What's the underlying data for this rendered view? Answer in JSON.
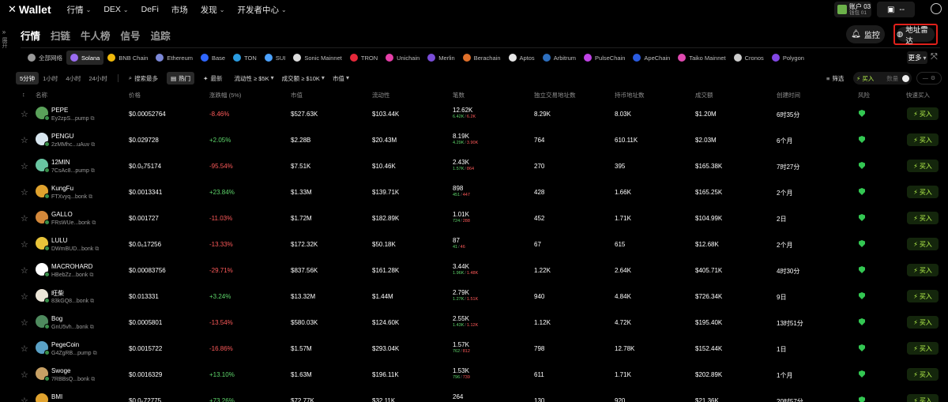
{
  "nav": {
    "logo_text": "Wallet",
    "items": [
      "行情",
      "DEX",
      "DeFi",
      "市场",
      "发现",
      "开发者中心"
    ],
    "account_name": "账户 03",
    "account_sub": "钱包 01",
    "account2_text": "--"
  },
  "sidebar": {
    "label": "展开"
  },
  "page_tabs": [
    "行情",
    "扫链",
    "牛人榜",
    "信号",
    "追踪"
  ],
  "actions": {
    "monitor": "监控",
    "address_radar": "地址雷达"
  },
  "chains": [
    {
      "name": "全部网络",
      "color": "#999999"
    },
    {
      "name": "Solana",
      "color": "#9a6cf0"
    },
    {
      "name": "BNB Chain",
      "color": "#f0b90b"
    },
    {
      "name": "Ethereum",
      "color": "#7c88d8"
    },
    {
      "name": "Base",
      "color": "#2f66ff"
    },
    {
      "name": "TON",
      "color": "#2a9be0"
    },
    {
      "name": "SUI",
      "color": "#4ca2ff"
    },
    {
      "name": "Sonic Mainnet",
      "color": "#dddddd"
    },
    {
      "name": "TRON",
      "color": "#e6283a"
    },
    {
      "name": "Unichain",
      "color": "#e63fa8"
    },
    {
      "name": "Merlin",
      "color": "#7a4dd8"
    },
    {
      "name": "Berachain",
      "color": "#e0702a"
    },
    {
      "name": "Aptos",
      "color": "#e6e6e6"
    },
    {
      "name": "Arbitrum",
      "color": "#2d6fbf"
    },
    {
      "name": "PulseChain",
      "color": "#c043e6"
    },
    {
      "name": "ApeChain",
      "color": "#2a5be0"
    },
    {
      "name": "Taiko Mainnet",
      "color": "#e04ab0"
    },
    {
      "name": "Cronos",
      "color": "#cccccc"
    },
    {
      "name": "Polygon",
      "color": "#8247e5"
    }
  ],
  "more_label": "更多",
  "filters": {
    "timeframes": [
      "5分钟",
      "1小时",
      "4小时",
      "24小时"
    ],
    "sorts": [
      "搜索最多",
      "热门",
      "最新"
    ],
    "dropdowns": [
      "流动性 ≥ $5K",
      "成交额 ≥ $10K",
      "市值"
    ],
    "screen": "筛选",
    "buy": "买入",
    "amount_placeholder": "数量",
    "settings": "—"
  },
  "columns": [
    "名称",
    "价格",
    "涨跌幅 (5%)",
    "市值",
    "流动性",
    "笔数",
    "独立交易地址数",
    "持币地址数",
    "成交额",
    "创建时间",
    "风险",
    "快速买入"
  ],
  "buy_label": "买入",
  "tokens": [
    {
      "name": "PEPE",
      "addr": "Ey2zpS...pump",
      "price": "$0.00052764",
      "change": "-8.46%",
      "dir": "down",
      "mcap": "$527.63K",
      "liq": "$103.44K",
      "tx": "12.62K",
      "txb": "6.42K",
      "txs": "6.2K",
      "traders": "8.29K",
      "holders": "8.03K",
      "vol": "$1.20M",
      "age": "6时35分",
      "color": "#5aa15a"
    },
    {
      "name": "PENGU",
      "addr": "2zMMhc...uAuv",
      "price": "$0.029728",
      "change": "+2.05%",
      "dir": "up",
      "mcap": "$2.28B",
      "liq": "$20.43M",
      "tx": "8.19K",
      "txb": "4.29K",
      "txs": "3.90K",
      "traders": "764",
      "holders": "610.11K",
      "vol": "$2.03M",
      "age": "6个月",
      "color": "#d8e6ef"
    },
    {
      "name": "12MIN",
      "addr": "7CsAc8...pump",
      "price": "$0.0₆75174",
      "change": "-95.54%",
      "dir": "down",
      "mcap": "$7.51K",
      "liq": "$10.46K",
      "tx": "2.43K",
      "txb": "1.57K",
      "txs": "864",
      "traders": "270",
      "holders": "395",
      "vol": "$165.38K",
      "age": "7时27分",
      "color": "#69c6a2"
    },
    {
      "name": "KungFu",
      "addr": "FTXvyq...bonk",
      "price": "$0.0013341",
      "change": "+23.84%",
      "dir": "up",
      "mcap": "$1.33M",
      "liq": "$139.71K",
      "tx": "898",
      "txb": "451",
      "txs": "447",
      "traders": "428",
      "holders": "1.66K",
      "vol": "$165.25K",
      "age": "2个月",
      "color": "#e0a22e"
    },
    {
      "name": "GALLO",
      "addr": "FRsWUe...bonk",
      "price": "$0.001727",
      "change": "-11.03%",
      "dir": "down",
      "mcap": "$1.72M",
      "liq": "$182.89K",
      "tx": "1.01K",
      "txb": "724",
      "txs": "288",
      "traders": "452",
      "holders": "1.71K",
      "vol": "$104.99K",
      "age": "2日",
      "color": "#d4883a"
    },
    {
      "name": "LULU",
      "addr": "DWmBUD...bonk",
      "price": "$0.0₆17256",
      "change": "-13.33%",
      "dir": "down",
      "mcap": "$172.32K",
      "liq": "$50.18K",
      "tx": "87",
      "txb": "41",
      "txs": "46",
      "traders": "67",
      "holders": "615",
      "vol": "$12.68K",
      "age": "2个月",
      "color": "#e8c43a"
    },
    {
      "name": "MACROHARD",
      "addr": "HBebZz...bonk",
      "price": "$0.00083756",
      "change": "-29.71%",
      "dir": "down",
      "mcap": "$837.56K",
      "liq": "$161.28K",
      "tx": "3.44K",
      "txb": "1.96K",
      "txs": "1.48K",
      "traders": "1.22K",
      "holders": "2.64K",
      "vol": "$405.71K",
      "age": "4时30分",
      "color": "#ffffff"
    },
    {
      "name": "旺柴",
      "addr": "83kGQ8...bonk",
      "price": "$0.013331",
      "change": "+3.24%",
      "dir": "up",
      "mcap": "$13.32M",
      "liq": "$1.44M",
      "tx": "2.79K",
      "txb": "1.27K",
      "txs": "1.51K",
      "traders": "940",
      "holders": "4.84K",
      "vol": "$726.34K",
      "age": "9日",
      "color": "#ece6d8"
    },
    {
      "name": "Bog",
      "addr": "GnU5vh...bonk",
      "price": "$0.0005801",
      "change": "-13.54%",
      "dir": "down",
      "mcap": "$580.03K",
      "liq": "$124.60K",
      "tx": "2.55K",
      "txb": "1.43K",
      "txs": "1.12K",
      "traders": "1.12K",
      "holders": "4.72K",
      "vol": "$195.40K",
      "age": "13时51分",
      "color": "#4e8a5e"
    },
    {
      "name": "PegeCoin",
      "addr": "G4ZgRB...pump",
      "price": "$0.0015722",
      "change": "-16.86%",
      "dir": "down",
      "mcap": "$1.57M",
      "liq": "$293.04K",
      "tx": "1.57K",
      "txb": "762",
      "txs": "812",
      "traders": "798",
      "holders": "12.78K",
      "vol": "$152.44K",
      "age": "1日",
      "color": "#5aa1c6"
    },
    {
      "name": "Swoge",
      "addr": "7RBBsQ...bonk",
      "price": "$0.0016329",
      "change": "+13.10%",
      "dir": "up",
      "mcap": "$1.63M",
      "liq": "$196.11K",
      "tx": "1.53K",
      "txb": "796",
      "txs": "739",
      "traders": "611",
      "holders": "1.71K",
      "vol": "$202.89K",
      "age": "1个月",
      "color": "#c7a064"
    },
    {
      "name": "BMI",
      "addr": "",
      "price": "$0.0₆72775",
      "change": "+73.26%",
      "dir": "up",
      "mcap": "$72.77K",
      "liq": "$32.11K",
      "tx": "264",
      "txb": "",
      "txs": "",
      "traders": "130",
      "holders": "920",
      "vol": "$21.36K",
      "age": "20时57分",
      "color": "#e0a22e"
    }
  ]
}
